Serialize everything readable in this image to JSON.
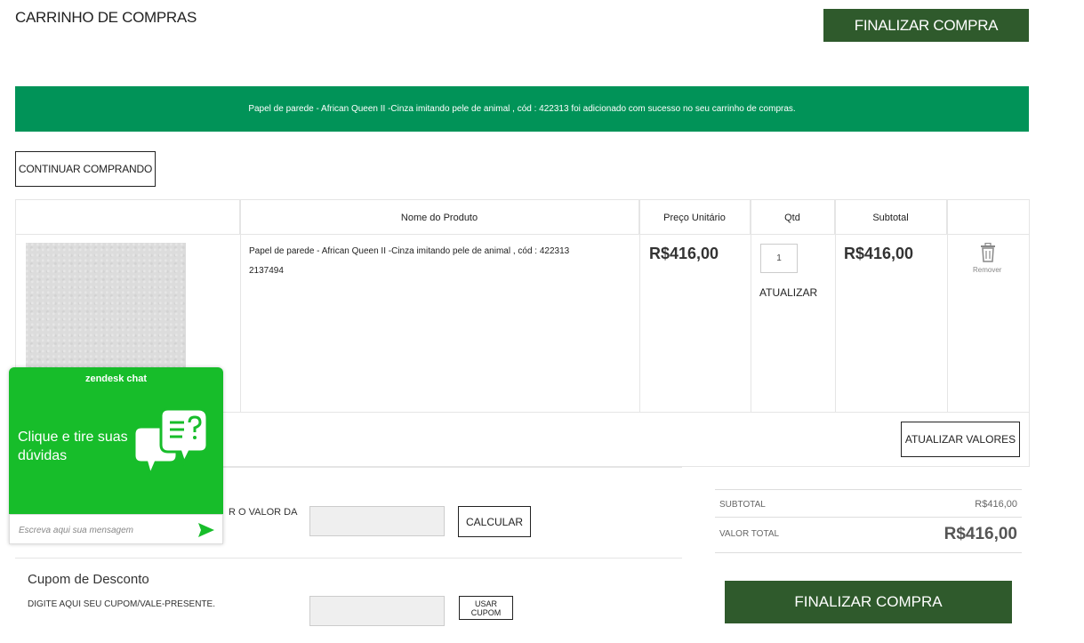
{
  "header": {
    "title": "CARRINHO DE COMPRAS",
    "checkout_label": "FINALIZAR COMPRA"
  },
  "banner": {
    "message": "Papel de parede - African Queen II -Cinza imitando pele de animal , cód : 422313 foi adicionado com sucesso no seu carrinho de compras."
  },
  "actions": {
    "continue_label": "CONTINUAR COMPRANDO",
    "update_values_label": "ATUALIZAR VALORES"
  },
  "table": {
    "headers": {
      "name": "Nome do Produto",
      "unit_price": "Preço Unitário",
      "qty": "Qtd",
      "subtotal": "Subtotal"
    },
    "item": {
      "name": "Papel de parede - African Queen II -Cinza imitando pele de animal , cód : 422313",
      "sku": "2137494",
      "unit_price": "R$416,00",
      "qty": "1",
      "update_label": "ATUALIZAR",
      "subtotal": "R$416,00",
      "remove_label": "Remover"
    }
  },
  "shipping": {
    "label_partial": "R O VALOR DA",
    "calc_label": "CALCULAR"
  },
  "coupon": {
    "title": "Cupom de Desconto",
    "label": "DIGITE AQUI SEU CUPOM/VALE-PRESENTE.",
    "button_label": "USAR CUPOM"
  },
  "summary": {
    "subtotal_label": "SUBTOTAL",
    "subtotal_value": "R$416,00",
    "total_label": "VALOR TOTAL",
    "total_value": "R$416,00",
    "checkout_label": "FINALIZAR COMPRA"
  },
  "chat": {
    "brand": "zendesk chat",
    "prompt": "Clique e tire suas dúvidas",
    "placeholder": "Escreva aqui sua mensagem",
    "color": "#17bd2a"
  },
  "colors": {
    "brand_green": "#2f5a2c",
    "success_green": "#019358"
  },
  "icons": {
    "remove": "trash-icon",
    "chat": "chat-bubbles-icon",
    "send": "send-icon"
  }
}
